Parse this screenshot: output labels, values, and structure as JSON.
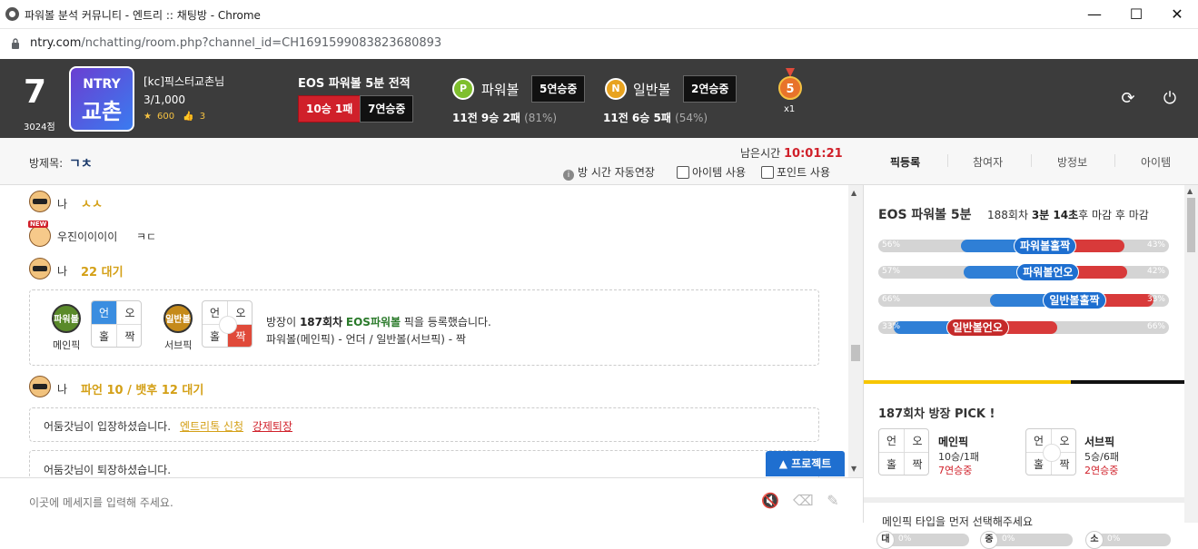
{
  "window": {
    "title": "파워볼 분석 커뮤니티 - 엔트리 :: 채팅방 - Chrome",
    "min": "—",
    "max": "☐",
    "close": "✕"
  },
  "address": {
    "host": "ntry.com",
    "path": "/nchatting/room.php?channel_id=CH1691599083823680893"
  },
  "header": {
    "level": "7",
    "points": "3024점",
    "logo_top": "NTRY",
    "logo_bottom": "교촌",
    "user_name": "[kc]픽스터교촌님",
    "user_count": "3/1,000",
    "stars": "600",
    "likes": "3",
    "record_title": "EOS 파워볼 5분 전적",
    "record_badge_1": "10승 1패",
    "record_badge_2": "7연승중",
    "powerball": {
      "icon": "P",
      "name": "파워볼",
      "streak": "5연승중",
      "rec_main": "11전 9승 2패",
      "rec_pct": "(81%)"
    },
    "normalball": {
      "icon": "N",
      "name": "일반볼",
      "streak": "2연승중",
      "rec_main": "11전 6승 5패",
      "rec_pct": "(54%)"
    },
    "medal_num": "5",
    "medal_x": "x1",
    "colors": {
      "bg": "#3c3c3c",
      "red": "#d0202a"
    }
  },
  "room": {
    "label": "방제목:",
    "title": "ㄱㅊ",
    "remain_label": "남은시간",
    "remain_time": "10:01:21",
    "auto_extend": "방 시간 자동연장",
    "item_use": "아이템 사용",
    "point_use": "포인트 사용"
  },
  "tabs": [
    "픽등록",
    "참여자",
    "방정보",
    "아이템"
  ],
  "chat": {
    "msgs": [
      {
        "nick": "나",
        "text": "ㅅㅅ"
      },
      {
        "nick": "우진이이이이",
        "text": "ㅋㄷ",
        "new": "NEW"
      },
      {
        "nick": "나",
        "text": "22 대기"
      },
      {
        "nick": "나",
        "text": "파언 10 / 뱃후 12 대기"
      }
    ],
    "pick_box": {
      "pw_icon": "파워볼",
      "pw_label": "메인픽",
      "nb_icon": "일반볼",
      "nb_label": "서브픽",
      "grid": [
        "언",
        "오",
        "홀",
        "짝"
      ],
      "line1_pre": "방장이 ",
      "line1_round": "187회차",
      "line1_game": "EOS파워볼",
      "line1_post": " 픽을 등록했습니다.",
      "line2": "파워볼(메인픽) - 언더 / 일반볼(서브픽) - 짝"
    },
    "enter": {
      "name": "어둠갓",
      "text": "님이 입장하셨습니다.",
      "link1": "엔트리톡 신청",
      "link2": "강제퇴장"
    },
    "leave": {
      "name": "어둠갓",
      "text": "님이 퇴장하셨습니다."
    },
    "project_btn": "▲ 프로젝트"
  },
  "input": {
    "placeholder": "이곳에 메세지를 입력해 주세요."
  },
  "panel": {
    "title": "EOS 파워볼 5분",
    "round": "188회차",
    "time_pre": "3분 ",
    "time_sec": "14초",
    "time_post": "후 마감 후 마감",
    "bars": [
      {
        "label": "파워볼홀짝",
        "left": "56%",
        "right": "43%",
        "left_value": 56,
        "right_value": 43,
        "style": "blue"
      },
      {
        "label": "파워볼언오",
        "left": "57%",
        "right": "42%",
        "left_value": 57,
        "right_value": 42,
        "style": "blue"
      },
      {
        "label": "일반볼홀짝",
        "left": "66%",
        "right": "33%",
        "left_value": 66,
        "right_value": 33,
        "style": "blue"
      },
      {
        "label": "일반볼언오",
        "left": "33%",
        "right": "66%",
        "left_value": 33,
        "right_value": 66,
        "style": "red"
      }
    ],
    "small": [
      {
        "c": "대",
        "v": "0%"
      },
      {
        "c": "중",
        "v": "0%"
      },
      {
        "c": "소",
        "v": "0%"
      }
    ],
    "pick_title": "187회차 방장 PICK !",
    "main": {
      "name": "메인픽",
      "rec": "10승/1패",
      "streak": "7연승중"
    },
    "sub": {
      "name": "서브픽",
      "rec": "5승/6패",
      "streak": "2연승중"
    },
    "note": "메인픽 타입을 먼저 선택해주세요"
  }
}
